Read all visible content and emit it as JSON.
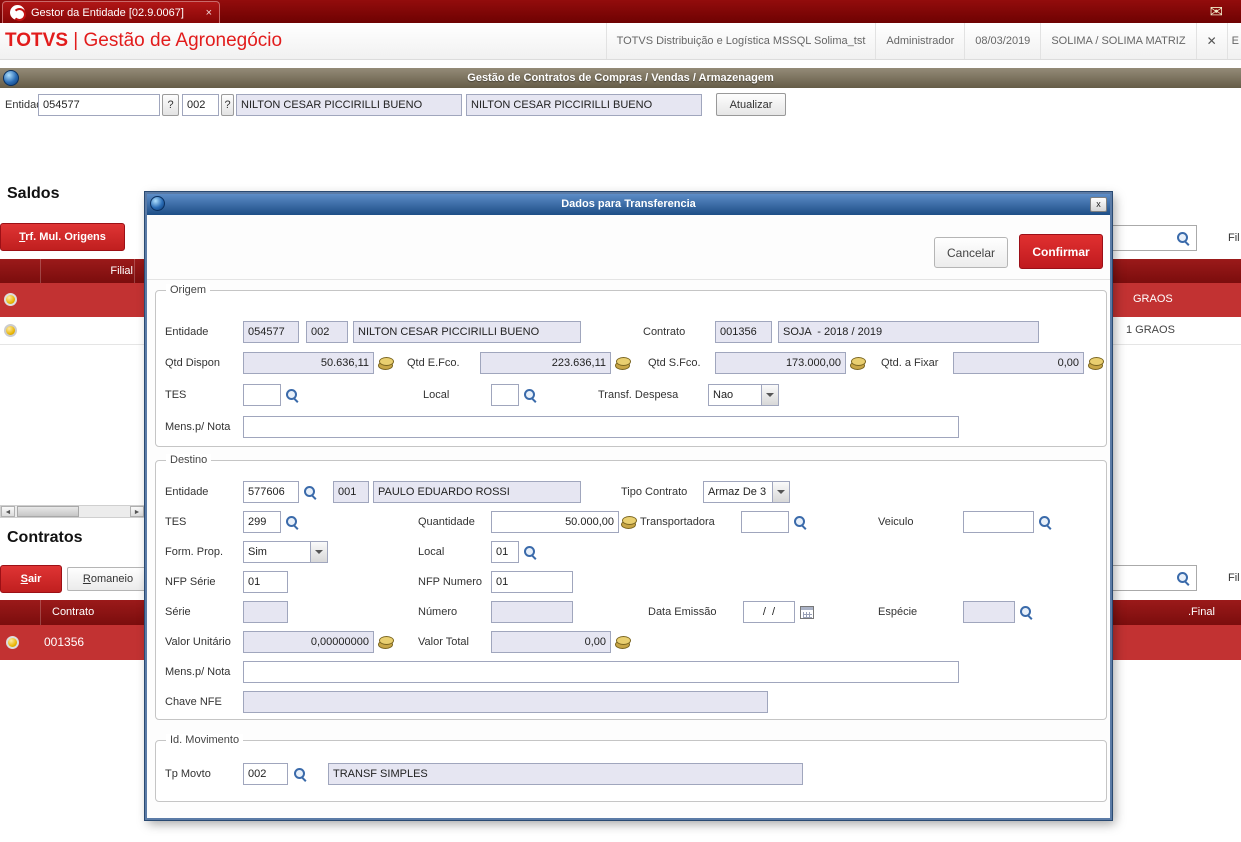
{
  "colors": {
    "brand_red": "#e21c1c",
    "button_red": "#d5202a",
    "grid_header_red": "#8a1414",
    "selected_row_red": "#c23232",
    "modal_title_blue": "#1d4e86",
    "readonly_input_bg": "#e6e6f2"
  },
  "icons": {
    "envelope": "✉",
    "arrow_left": "◄",
    "arrow_right": "►",
    "tab_close": "×",
    "header_close": "✕",
    "modal_close": "x"
  },
  "tab_bar": {
    "title": "Gestor da Entidade [02.9.0067]"
  },
  "header": {
    "brand_name": "TOTVS",
    "brand_module": "| Gestão de Agronegócio",
    "environment": "TOTVS Distribuição e Logística MSSQL Solima_tst",
    "user": "Administrador",
    "date": "08/03/2019",
    "branch": "SOLIMA / SOLIMA MATRIZ",
    "edge_text": "E"
  },
  "window_title": "Gestão de Contratos de Compras / Vendas / Armazenagem",
  "entity_bar": {
    "label": "Entidade",
    "entity_code": "054577",
    "lookup1": "?",
    "store_code": "002",
    "lookup2": "?",
    "entity_name": "NILTON CESAR PICCIRILLI BUENO",
    "entity_name2": "NILTON CESAR PICCIRILLI BUENO",
    "refresh_button": "Atualizar"
  },
  "saldos": {
    "heading": "Saldos",
    "trf_button": {
      "hotkey": "T",
      "rest": "rf. Mul. Origens"
    },
    "search_value": "",
    "filter_hint": "Fil",
    "grid": {
      "col_filial": "Filial",
      "rows": [
        {
          "right_text": "GRAOS"
        },
        {
          "right_text": "1 GRAOS"
        }
      ]
    }
  },
  "contratos": {
    "heading": "Contratos",
    "sair_button": {
      "hotkey": "S",
      "rest": "air"
    },
    "romaneio_button": {
      "hotkey": "R",
      "rest": "omaneio"
    },
    "search_value": "",
    "filter_hint": "Fil",
    "grid": {
      "col_contrato": "Contrato",
      "col_final": ".Final",
      "rows": [
        {
          "contrato": "001356"
        }
      ]
    }
  },
  "modal": {
    "title": "Dados para Transferencia",
    "cancel_button": "Cancelar",
    "confirm_button": "Confirmar",
    "origem": {
      "legend": "Origem",
      "entidade_label": "Entidade",
      "entidade_code": "054577",
      "entidade_store": "002",
      "entidade_name": "NILTON CESAR PICCIRILLI BUENO",
      "contrato_label": "Contrato",
      "contrato_code": "001356",
      "contrato_desc": "SOJA  - 2018 / 2019",
      "qtd_dispon_label": "Qtd Dispon",
      "qtd_dispon": "50.636,11",
      "qtd_efco_label": "Qtd E.Fco.",
      "qtd_efco": "223.636,11",
      "qtd_sfco_label": "Qtd S.Fco.",
      "qtd_sfco": "173.000,00",
      "qtd_fixar_label": "Qtd. a Fixar",
      "qtd_fixar": "0,00",
      "tes_label": "TES",
      "tes": "",
      "local_label": "Local",
      "local": "",
      "transf_despesa_label": "Transf. Despesa",
      "transf_despesa": "Nao",
      "mens_label": "Mens.p/ Nota",
      "mens": ""
    },
    "destino": {
      "legend": "Destino",
      "entidade_label": "Entidade",
      "entidade_code": "577606",
      "entidade_store": "001",
      "entidade_name": "PAULO EDUARDO ROSSI",
      "tipo_contrato_label": "Tipo Contrato",
      "tipo_contrato": "Armaz De 3",
      "tes_label": "TES",
      "tes": "299",
      "quantidade_label": "Quantidade",
      "quantidade": "50.000,00",
      "transportadora_label": "Transportadora",
      "transportadora": "",
      "veiculo_label": "Veiculo",
      "veiculo": "",
      "form_prop_label": "Form. Prop.",
      "form_prop": "Sim",
      "local_label": "Local",
      "local": "01",
      "nfp_serie_label": "NFP Série",
      "nfp_serie": "01",
      "nfp_numero_label": "NFP Numero",
      "nfp_numero": "01",
      "serie_label": "Série",
      "serie": "",
      "numero_label": "Número",
      "numero": "",
      "data_emissao_label": "Data Emissão",
      "data_emissao": "/  /",
      "especie_label": "Espécie",
      "especie": "",
      "valor_unitario_label": "Valor Unitário",
      "valor_unitario": "0,00000000",
      "valor_total_label": "Valor Total",
      "valor_total": "0,00",
      "mens_label": "Mens.p/ Nota",
      "mens": "",
      "chave_nfe_label": "Chave NFE",
      "chave_nfe": ""
    },
    "movimento": {
      "legend": "Id. Movimento",
      "tp_movto_label": "Tp Movto",
      "tp_movto": "002",
      "tp_movto_desc": "TRANSF SIMPLES"
    }
  }
}
